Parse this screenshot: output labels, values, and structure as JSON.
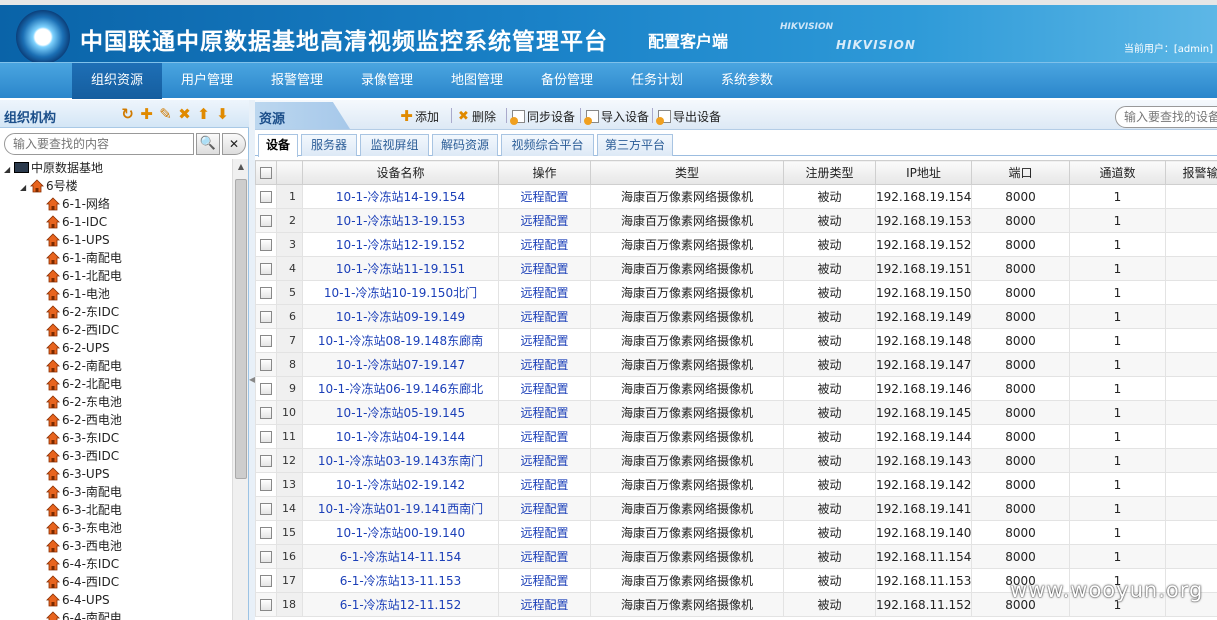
{
  "header": {
    "title": "中国联通中原数据基地高清视频监控系统管理平台",
    "subtitle": "配置客户端",
    "brand_small": "HIKVISION",
    "brand_large": "HIKVISION",
    "user_info": "当前用户：[admin]"
  },
  "nav": {
    "items": [
      "组织资源",
      "用户管理",
      "报警管理",
      "录像管理",
      "地图管理",
      "备份管理",
      "任务计划",
      "系统参数"
    ],
    "active": 0
  },
  "left": {
    "title": "组织机构",
    "toolbar_icons": [
      "sync-tree-icon",
      "add-icon",
      "edit-icon",
      "delete-icon",
      "move-up-icon",
      "move-down-icon"
    ],
    "search_placeholder": "输入要查找的内容",
    "tree": {
      "root": "中原数据基地",
      "building": "6号楼",
      "nodes": [
        "6-1-网络",
        "6-1-IDC",
        "6-1-UPS",
        "6-1-南配电",
        "6-1-北配电",
        "6-1-电池",
        "6-2-东IDC",
        "6-2-西IDC",
        "6-2-UPS",
        "6-2-南配电",
        "6-2-北配电",
        "6-2-东电池",
        "6-2-西电池",
        "6-3-东IDC",
        "6-3-西IDC",
        "6-3-UPS",
        "6-3-南配电",
        "6-3-北配电",
        "6-3-东电池",
        "6-3-西电池",
        "6-4-东IDC",
        "6-4-西IDC",
        "6-4-UPS",
        "6-4-南配电"
      ]
    }
  },
  "right": {
    "title": "资源",
    "actions": [
      "添加",
      "删除",
      "同步设备",
      "导入设备",
      "导出设备"
    ],
    "search_placeholder": "输入要查找的设备",
    "tabs": [
      "设备",
      "服务器",
      "监视屏组",
      "解码资源",
      "视频综合平台",
      "第三方平台"
    ],
    "active_tab": 0,
    "columns": [
      "设备名称",
      "操作",
      "类型",
      "注册类型",
      "IP地址",
      "端口",
      "通道数",
      "报警输"
    ],
    "rows": [
      {
        "n": "1",
        "name": "10-1-冷冻站14-19.154",
        "op": "远程配置",
        "type": "海康百万像素网络摄像机",
        "reg": "被动",
        "ip": "192.168.19.154",
        "port": "8000",
        "ch": "1"
      },
      {
        "n": "2",
        "name": "10-1-冷冻站13-19.153",
        "op": "远程配置",
        "type": "海康百万像素网络摄像机",
        "reg": "被动",
        "ip": "192.168.19.153",
        "port": "8000",
        "ch": "1"
      },
      {
        "n": "3",
        "name": "10-1-冷冻站12-19.152",
        "op": "远程配置",
        "type": "海康百万像素网络摄像机",
        "reg": "被动",
        "ip": "192.168.19.152",
        "port": "8000",
        "ch": "1"
      },
      {
        "n": "4",
        "name": "10-1-冷冻站11-19.151",
        "op": "远程配置",
        "type": "海康百万像素网络摄像机",
        "reg": "被动",
        "ip": "192.168.19.151",
        "port": "8000",
        "ch": "1"
      },
      {
        "n": "5",
        "name": "10-1-冷冻站10-19.150北门",
        "op": "远程配置",
        "type": "海康百万像素网络摄像机",
        "reg": "被动",
        "ip": "192.168.19.150",
        "port": "8000",
        "ch": "1"
      },
      {
        "n": "6",
        "name": "10-1-冷冻站09-19.149",
        "op": "远程配置",
        "type": "海康百万像素网络摄像机",
        "reg": "被动",
        "ip": "192.168.19.149",
        "port": "8000",
        "ch": "1"
      },
      {
        "n": "7",
        "name": "10-1-冷冻站08-19.148东廊南",
        "op": "远程配置",
        "type": "海康百万像素网络摄像机",
        "reg": "被动",
        "ip": "192.168.19.148",
        "port": "8000",
        "ch": "1"
      },
      {
        "n": "8",
        "name": "10-1-冷冻站07-19.147",
        "op": "远程配置",
        "type": "海康百万像素网络摄像机",
        "reg": "被动",
        "ip": "192.168.19.147",
        "port": "8000",
        "ch": "1"
      },
      {
        "n": "9",
        "name": "10-1-冷冻站06-19.146东廊北",
        "op": "远程配置",
        "type": "海康百万像素网络摄像机",
        "reg": "被动",
        "ip": "192.168.19.146",
        "port": "8000",
        "ch": "1"
      },
      {
        "n": "10",
        "name": "10-1-冷冻站05-19.145",
        "op": "远程配置",
        "type": "海康百万像素网络摄像机",
        "reg": "被动",
        "ip": "192.168.19.145",
        "port": "8000",
        "ch": "1"
      },
      {
        "n": "11",
        "name": "10-1-冷冻站04-19.144",
        "op": "远程配置",
        "type": "海康百万像素网络摄像机",
        "reg": "被动",
        "ip": "192.168.19.144",
        "port": "8000",
        "ch": "1"
      },
      {
        "n": "12",
        "name": "10-1-冷冻站03-19.143东南门",
        "op": "远程配置",
        "type": "海康百万像素网络摄像机",
        "reg": "被动",
        "ip": "192.168.19.143",
        "port": "8000",
        "ch": "1"
      },
      {
        "n": "13",
        "name": "10-1-冷冻站02-19.142",
        "op": "远程配置",
        "type": "海康百万像素网络摄像机",
        "reg": "被动",
        "ip": "192.168.19.142",
        "port": "8000",
        "ch": "1"
      },
      {
        "n": "14",
        "name": "10-1-冷冻站01-19.141西南门",
        "op": "远程配置",
        "type": "海康百万像素网络摄像机",
        "reg": "被动",
        "ip": "192.168.19.141",
        "port": "8000",
        "ch": "1"
      },
      {
        "n": "15",
        "name": "10-1-冷冻站00-19.140",
        "op": "远程配置",
        "type": "海康百万像素网络摄像机",
        "reg": "被动",
        "ip": "192.168.19.140",
        "port": "8000",
        "ch": "1"
      },
      {
        "n": "16",
        "name": "6-1-冷冻站14-11.154",
        "op": "远程配置",
        "type": "海康百万像素网络摄像机",
        "reg": "被动",
        "ip": "192.168.11.154",
        "port": "8000",
        "ch": "1"
      },
      {
        "n": "17",
        "name": "6-1-冷冻站13-11.153",
        "op": "远程配置",
        "type": "海康百万像素网络摄像机",
        "reg": "被动",
        "ip": "192.168.11.153",
        "port": "8000",
        "ch": "1"
      },
      {
        "n": "18",
        "name": "6-1-冷冻站12-11.152",
        "op": "远程配置",
        "type": "海康百万像素网络摄像机",
        "reg": "被动",
        "ip": "192.168.11.152",
        "port": "8000",
        "ch": "1"
      }
    ]
  },
  "watermark": "www.wooyun.org",
  "colors": {
    "header": "#1a82c8",
    "nav": "#2b86cb",
    "link": "#1b3fb8",
    "house": "#e8641e"
  }
}
